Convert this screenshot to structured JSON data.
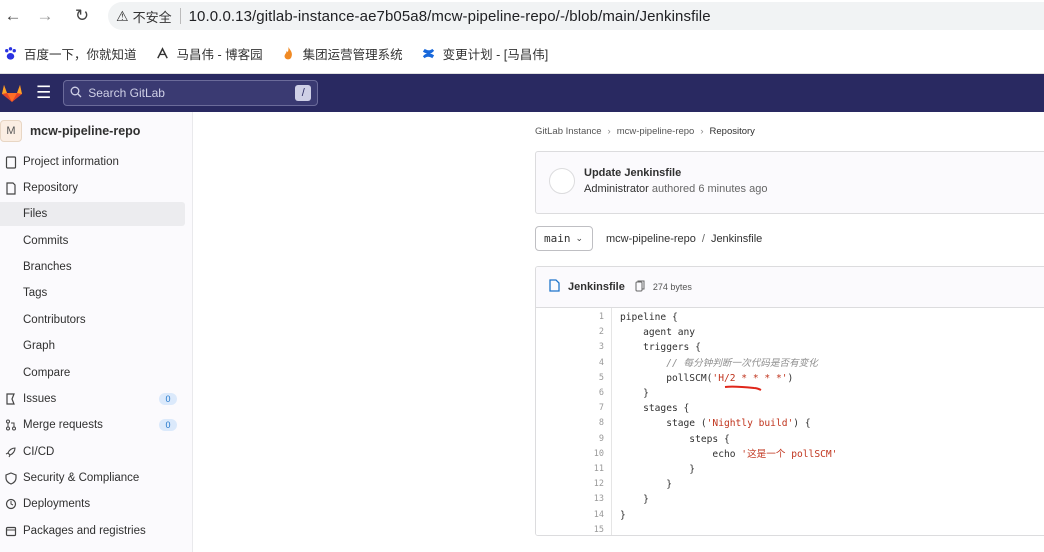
{
  "browser": {
    "insecure_label": "不安全",
    "url": "10.0.0.13/gitlab-instance-ae7b05a8/mcw-pipeline-repo/-/blob/main/Jenkinsfile",
    "bookmarks": [
      {
        "label": "百度一下，你就知道",
        "icon": "paw-icon"
      },
      {
        "label": "马昌伟 - 博客园",
        "icon": "blog-icon"
      },
      {
        "label": "集团运营管理系统",
        "icon": "flame-icon"
      },
      {
        "label": "变更计划 - [马昌伟]",
        "icon": "confluence-icon"
      }
    ]
  },
  "topnav": {
    "search_placeholder": "Search GitLab",
    "search_shortcut": "/"
  },
  "sidebar": {
    "project_initial": "M",
    "project_name": "mcw-pipeline-repo",
    "items": [
      {
        "label": "Project information",
        "icon": "info-icon"
      },
      {
        "label": "Repository",
        "icon": "doc-icon"
      },
      {
        "label": "Files",
        "sub": true,
        "active": true
      },
      {
        "label": "Commits",
        "sub": true
      },
      {
        "label": "Branches",
        "sub": true
      },
      {
        "label": "Tags",
        "sub": true
      },
      {
        "label": "Contributors",
        "sub": true
      },
      {
        "label": "Graph",
        "sub": true
      },
      {
        "label": "Compare",
        "sub": true
      },
      {
        "label": "Issues",
        "icon": "issues-icon",
        "badge": "0"
      },
      {
        "label": "Merge requests",
        "icon": "merge-icon",
        "badge": "0"
      },
      {
        "label": "CI/CD",
        "icon": "rocket-icon"
      },
      {
        "label": "Security & Compliance",
        "icon": "shield-icon"
      },
      {
        "label": "Deployments",
        "icon": "deploy-icon"
      },
      {
        "label": "Packages and registries",
        "icon": "package-icon"
      }
    ]
  },
  "breadcrumb": [
    "GitLab Instance",
    "mcw-pipeline-repo",
    "Repository"
  ],
  "commit": {
    "title": "Update Jenkinsfile",
    "author": "Administrator",
    "rest": "authored 6 minutes ago"
  },
  "branch": "main",
  "path": {
    "repo": "mcw-pipeline-repo",
    "file": "Jenkinsfile"
  },
  "file": {
    "name": "Jenkinsfile",
    "size": "274 bytes"
  },
  "code_lines": [
    "pipeline {",
    "    agent any",
    "    triggers {",
    "        // 每分钟判断一次代码是否有变化",
    "        pollSCM('H/2 * * * *')",
    "    }",
    "    stages {",
    "        stage ('Nightly build') {",
    "            steps {",
    "                echo '这是一个 pollSCM'",
    "            }",
    "        }",
    "    }",
    "}",
    ""
  ],
  "colors": {
    "topnav": "#292961",
    "string": "#c0341d",
    "link": "#1f75cb",
    "annotation": "#e0261a"
  }
}
